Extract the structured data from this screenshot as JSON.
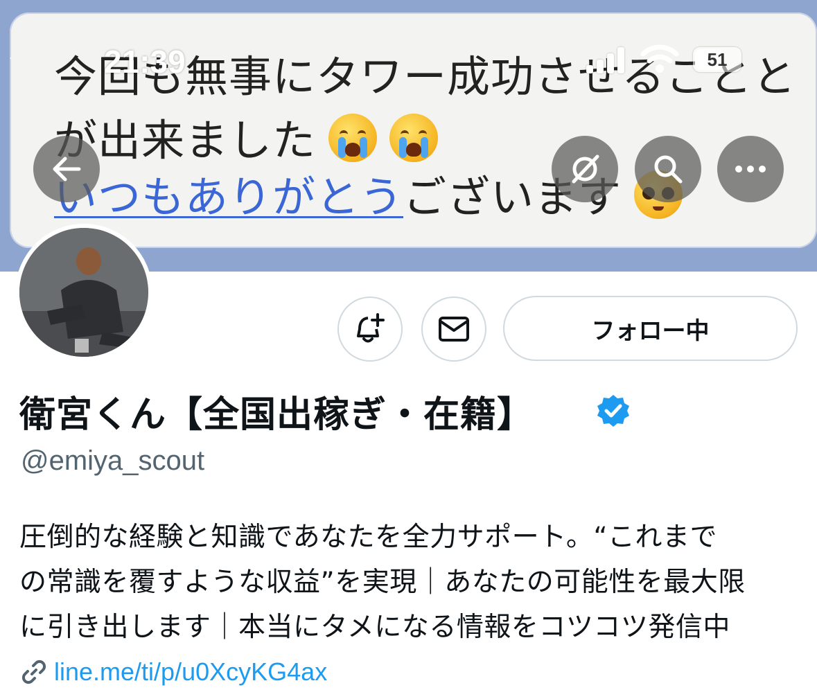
{
  "status_bar": {
    "time": "21:39",
    "battery": "51"
  },
  "banner": {
    "line1": "今回も無事にタワー成功させることと",
    "line2": "が出来ました",
    "line3_link": "いつもありがとう",
    "line3_rest": "ございます"
  },
  "nav": {
    "back_icon": "arrow-left-icon",
    "refresh_icon": "no-refresh-icon",
    "search_icon": "search-icon",
    "more_icon": "more-icon"
  },
  "actions": {
    "notify_icon": "bell-plus-icon",
    "message_icon": "mail-icon",
    "follow_label": "フォロー中"
  },
  "profile": {
    "display_name": "衛宮くん【全国出稼ぎ・在籍】",
    "handle": "@emiya_scout",
    "bio_lines": [
      "圧倒的な経験と知識であなたを全力サポート。“これまで",
      "の常識を覆すような収益”を実現｜あなたの可能性を最大限",
      "に引き出します｜本当にタメになる情報をコツコツ発信中"
    ],
    "link": "line.me/ti/p/u0XcyKG4ax"
  },
  "colors": {
    "accent": "#1d9bf0",
    "verified": "#1d9bf0",
    "banner_bg": "#8ea6cf"
  }
}
